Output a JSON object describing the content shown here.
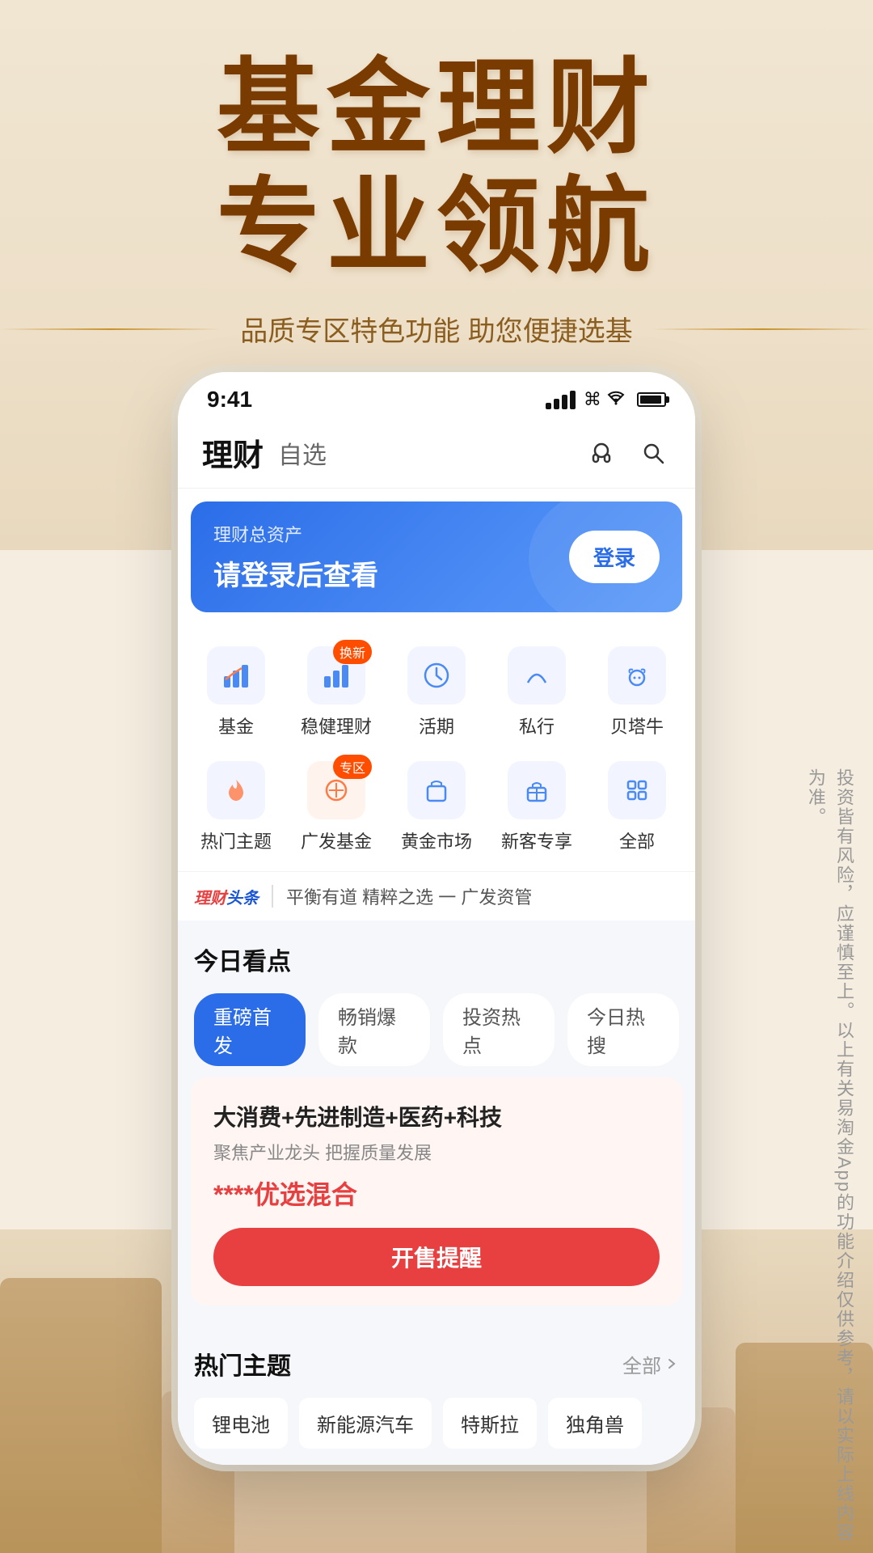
{
  "hero": {
    "title_line1": "基金理财",
    "title_line2": "专业领航",
    "subtitle": "品质专区特色功能 助您便捷选基"
  },
  "side_text": "投资皆有风险，应谨慎至上。以上有关易淘金App的功能介绍仅供参考，请以实际上线内容为准。",
  "status_bar": {
    "time": "9:41",
    "signal": "signal",
    "wifi": "wifi",
    "battery": "battery"
  },
  "nav": {
    "title_main": "理财",
    "title_sub": "自选",
    "icon_headset": "headset",
    "icon_search": "search"
  },
  "banner": {
    "label": "理财总资产",
    "main_text": "请登录后查看",
    "login_btn": "登录"
  },
  "icon_grid": {
    "items": [
      {
        "id": "fund",
        "label": "基金",
        "icon": "📈",
        "badge": ""
      },
      {
        "id": "stable",
        "label": "稳健理财",
        "icon": "📊",
        "badge": "换新"
      },
      {
        "id": "current",
        "label": "活期",
        "icon": "🕐",
        "badge": ""
      },
      {
        "id": "private",
        "label": "私行",
        "icon": "👑",
        "badge": ""
      },
      {
        "id": "beitaniu",
        "label": "贝塔牛",
        "icon": "🐂",
        "badge": ""
      },
      {
        "id": "hot_theme",
        "label": "热门主题",
        "icon": "🔥",
        "badge": ""
      },
      {
        "id": "guangfa",
        "label": "广发基金",
        "icon": "🎯",
        "badge": "专区"
      },
      {
        "id": "gold_market",
        "label": "黄金市场",
        "icon": "🏦",
        "badge": ""
      },
      {
        "id": "new_client",
        "label": "新客专享",
        "icon": "🎁",
        "badge": ""
      },
      {
        "id": "all",
        "label": "全部",
        "icon": "⊞",
        "badge": ""
      }
    ]
  },
  "news_ticker": {
    "brand": "理财头条",
    "divider": "|",
    "text": "平衡有道 精粹之选 一 广发资管"
  },
  "today_section": {
    "title": "今日看点",
    "tabs": [
      {
        "id": "new_launch",
        "label": "重磅首发",
        "active": true
      },
      {
        "id": "bestseller",
        "label": "畅销爆款",
        "active": false
      },
      {
        "id": "hot_invest",
        "label": "投资热点",
        "active": false
      },
      {
        "id": "hot_search",
        "label": "今日热搜",
        "active": false
      }
    ]
  },
  "fund_card": {
    "title": "大消费+先进制造+医药+科技",
    "subtitle": "聚焦产业龙头 把握质量发展",
    "name": "****优选混合",
    "btn_label": "开售提醒"
  },
  "hot_section": {
    "title": "热门主题",
    "more_label": "全部"
  },
  "hot_tags": [
    {
      "id": "lithium",
      "label": "锂电池",
      "active": false
    },
    {
      "id": "ev",
      "label": "新能源汽车",
      "active": false
    },
    {
      "id": "tesla",
      "label": "特斯拉",
      "active": false
    },
    {
      "id": "unicorn",
      "label": "独角兽",
      "active": false
    }
  ]
}
